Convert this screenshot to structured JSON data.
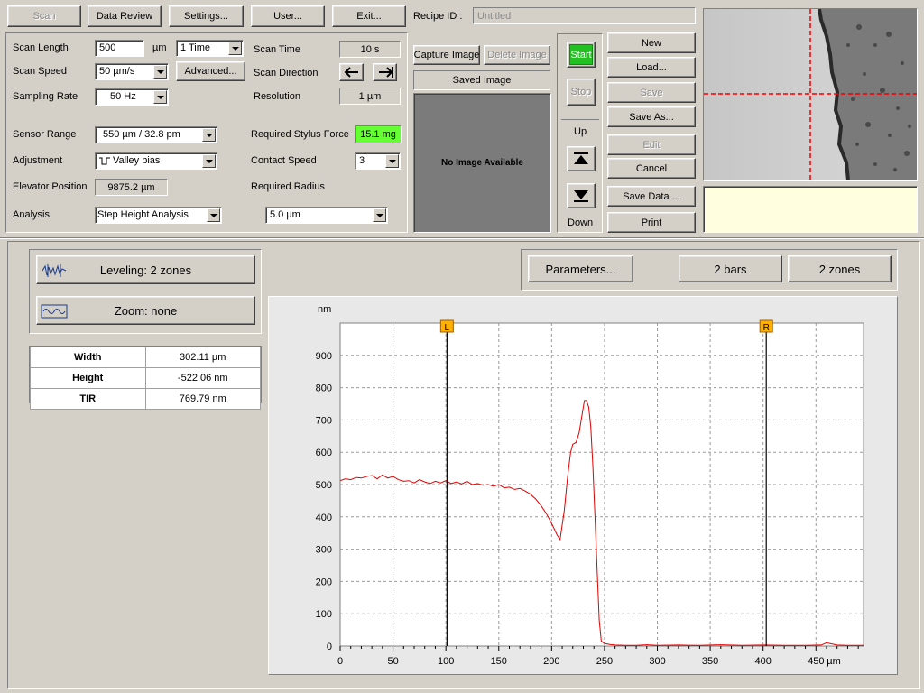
{
  "toolbar": {
    "scan": "Scan",
    "data_review": "Data Review",
    "settings": "Settings...",
    "user": "User...",
    "exit": "Exit..."
  },
  "recipe": {
    "label": "Recipe ID :",
    "value": "Untitled"
  },
  "params": {
    "scan_length_label": "Scan Length",
    "scan_length_value": "500",
    "scan_length_unit": "µm",
    "repeat_value": "1 Time",
    "scan_speed_label": "Scan Speed",
    "scan_speed_value": "50 µm/s",
    "advanced": "Advanced...",
    "sampling_rate_label": "Sampling Rate",
    "sampling_rate_value": "50 Hz",
    "sensor_range_label": "Sensor Range",
    "sensor_range_value": "550 µm / 32.8 pm",
    "adjustment_label": "Adjustment",
    "adjustment_value": "Valley bias",
    "elevator_label": "Elevator Position",
    "elevator_value": "9875.2 µm",
    "analysis_label": "Analysis",
    "analysis_value": "Step Height Analysis",
    "scan_time_label": "Scan Time",
    "scan_time_value": "10 s",
    "scan_direction_label": "Scan Direction",
    "resolution_label": "Resolution",
    "resolution_value": "1 µm",
    "stylus_force_label": "Required Stylus Force",
    "stylus_force_value": "15.1 mg",
    "contact_speed_label": "Contact Speed",
    "contact_speed_value": "3",
    "radius_label": "Required Radius",
    "radius_value": "5.0 µm"
  },
  "image": {
    "capture": "Capture Image",
    "delete": "Delete Image",
    "saved": "Saved Image",
    "none": "No Image Available"
  },
  "motion": {
    "start": "Start",
    "stop": "Stop",
    "up": "Up",
    "down": "Down"
  },
  "file": {
    "new": "New",
    "load": "Load...",
    "save": "Save",
    "save_as": "Save As...",
    "edit": "Edit",
    "cancel": "Cancel",
    "save_data": "Save Data ...",
    "print": "Print"
  },
  "analysis_panel": {
    "leveling": "Leveling: 2 zones",
    "zoom": "Zoom: none",
    "parameters": "Parameters...",
    "bars": "2 bars",
    "zones": "2 zones"
  },
  "results": [
    {
      "name": "Width",
      "value": "302.11 µm"
    },
    {
      "name": "Height",
      "value": "-522.06 nm"
    },
    {
      "name": "TIR",
      "value": "769.79 nm"
    }
  ],
  "colors": {
    "start": "#22c022",
    "force": "#66ff33",
    "trace": "#e00000",
    "marker": "#ffb000",
    "info": "#ffffe0"
  },
  "chart_data": {
    "type": "line",
    "ylabel": "nm",
    "xlabel": "µm",
    "xlim": [
      0,
      495
    ],
    "ylim": [
      0,
      1000
    ],
    "xticks": [
      0,
      50,
      100,
      150,
      200,
      250,
      300,
      350,
      400,
      450
    ],
    "yticks": [
      0,
      100,
      200,
      300,
      400,
      500,
      600,
      700,
      800,
      900
    ],
    "markers": [
      {
        "label": "L",
        "x": 101
      },
      {
        "label": "R",
        "x": 403
      }
    ],
    "series": [
      {
        "x": [
          0,
          5,
          10,
          15,
          20,
          25,
          30,
          35,
          40,
          45,
          50,
          55,
          60,
          65,
          70,
          75,
          80,
          85,
          90,
          95,
          100,
          105,
          110,
          115,
          120,
          125,
          130,
          135,
          140,
          145,
          150,
          155,
          160,
          165,
          170,
          175,
          180,
          185,
          190,
          195,
          200,
          205,
          208,
          212,
          215,
          218,
          220,
          223,
          226,
          229,
          231,
          233,
          235,
          237,
          239,
          241,
          243,
          245,
          247,
          250,
          255,
          260,
          270,
          280,
          290,
          300,
          320,
          340,
          360,
          380,
          400,
          420,
          440,
          455,
          460,
          470,
          480,
          495
        ],
        "y": [
          512,
          518,
          515,
          522,
          520,
          525,
          528,
          518,
          530,
          520,
          525,
          515,
          510,
          512,
          505,
          515,
          508,
          503,
          510,
          505,
          512,
          503,
          508,
          502,
          510,
          500,
          503,
          498,
          500,
          495,
          500,
          490,
          492,
          485,
          488,
          480,
          470,
          455,
          435,
          410,
          380,
          345,
          330,
          420,
          520,
          600,
          625,
          630,
          660,
          720,
          760,
          760,
          740,
          680,
          560,
          400,
          240,
          80,
          15,
          8,
          5,
          3,
          2,
          2,
          4,
          2,
          3,
          2,
          4,
          2,
          3,
          2,
          2,
          3,
          10,
          3,
          2,
          2
        ]
      }
    ]
  }
}
